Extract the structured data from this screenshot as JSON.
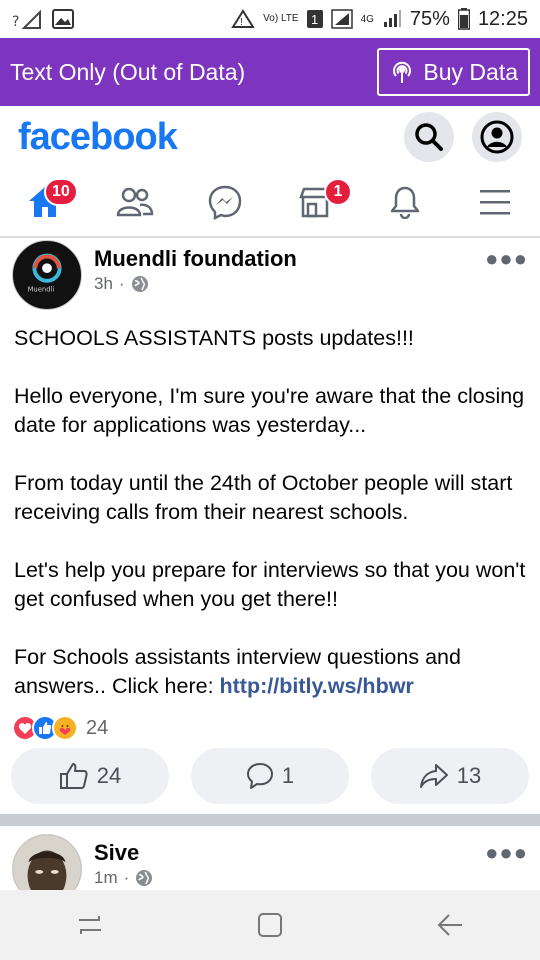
{
  "status_bar": {
    "carrier_indicator": "?",
    "network_label": "Vo) LTE",
    "sim_badge": "1",
    "net_4g": "4G",
    "battery": "75%",
    "time": "12:25"
  },
  "banner": {
    "title": "Text Only (Out of Data)",
    "buy_label": "Buy Data"
  },
  "header": {
    "logo": "facebook"
  },
  "tabs": {
    "home_badge": "10",
    "marketplace_badge": "1"
  },
  "post": {
    "author": "Muendli foundation",
    "time": "3h",
    "avatar_logo_text": "Muendli",
    "body": [
      "SCHOOLS ASSISTANTS posts updates!!!",
      "Hello everyone, I'm sure you're aware that the closing date for applications was yesterday...",
      "From today until the 24th of October people will start receiving calls from their nearest schools.",
      "Let's help you prepare for interviews so that you won't get confused when you get there!!"
    ],
    "last_paragraph_text": "For Schools assistants interview questions and answers.. Click here: ",
    "link": "http://bitly.ws/hbwr",
    "reaction_count": "24",
    "like_count": "24",
    "comment_count": "1",
    "share_count": "13"
  },
  "post2": {
    "author": "Sive",
    "time": "1m"
  },
  "colors": {
    "banner_purple": "#7d35c0",
    "facebook_blue": "#1877f2",
    "badge_red": "#e41e3f",
    "link_blue": "#385898"
  }
}
